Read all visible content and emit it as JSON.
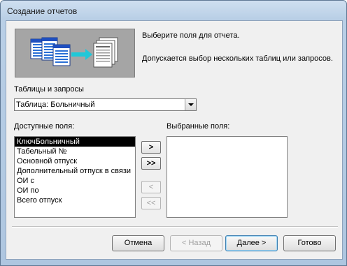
{
  "window": {
    "title": "Создание отчетов"
  },
  "header": {
    "line1": "Выберите поля для отчета.",
    "line2": "Допускается выбор нескольких таблиц или запросов."
  },
  "source": {
    "label": "Таблицы и запросы",
    "value": "Таблица: Больничный"
  },
  "available": {
    "label": "Доступные поля:",
    "items": [
      "КлючБольничный",
      "Табельный №",
      "Основной отпуск",
      "Дополнительный отпуск в связи",
      "ОИ с",
      "ОИ по",
      "Всего отпуск"
    ],
    "selected_index": 0
  },
  "selected_fields": {
    "label": "Выбранные поля:",
    "items": []
  },
  "move_buttons": {
    "add_one": ">",
    "add_all": ">>",
    "remove_one": "<",
    "remove_all": "<<"
  },
  "buttons": {
    "cancel": "Отмена",
    "back": "< Назад",
    "next": "Далее >",
    "finish": "Готово"
  }
}
